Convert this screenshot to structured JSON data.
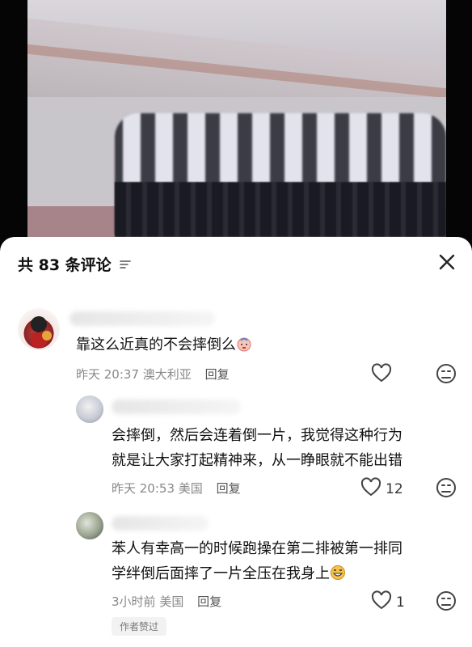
{
  "header": {
    "title": "共 83 条评论",
    "sort_icon": "sort-icon",
    "close_icon": "close-icon"
  },
  "comments": [
    {
      "text": "靠这么近真的不会摔倒么",
      "time": "昨天 20:37",
      "location": "澳大利亚",
      "reply_label": "回复",
      "likes": ""
    },
    {
      "text_line1": "会摔倒，然后会连着倒一片，我觉得这种行为",
      "text_line2": "就是让大家打起精神来，从一睁眼就不能出错",
      "time": "昨天 20:53",
      "location": "美国",
      "reply_label": "回复",
      "likes": "12"
    },
    {
      "text_line1": "苯人有幸高一的时候跑操在第二排被第一排同",
      "text_line2": "学绊倒后面摔了一片全压在我身上",
      "time": "3小时前",
      "location": "美国",
      "reply_label": "回复",
      "likes": "1",
      "badge": "作者赞过"
    }
  ],
  "colors": {
    "sheet_bg": "#ffffff",
    "text": "#111111",
    "meta": "#888888"
  }
}
